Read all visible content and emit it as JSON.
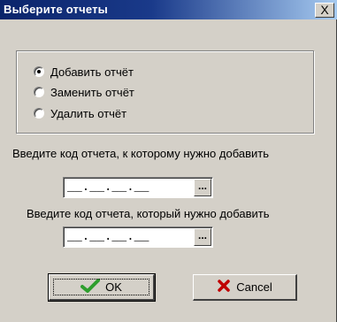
{
  "window": {
    "title": "Выберите отчеты",
    "close_label": "X"
  },
  "options": [
    {
      "label": "Добавить отчёт",
      "checked": true
    },
    {
      "label": "Заменить отчёт",
      "checked": false
    },
    {
      "label": "Удалить отчёт",
      "checked": false
    }
  ],
  "fields": {
    "target": {
      "prompt": "Введите код отчета, к которому нужно добавить",
      "value": "__.__.__.__",
      "button_label": "..."
    },
    "source": {
      "prompt": "Введите код отчета, который нужно добавить",
      "value": "__.__.__.__",
      "button_label": "..."
    }
  },
  "buttons": {
    "ok_label": "OK",
    "cancel_label": "Cancel"
  },
  "colors": {
    "title_bar": "#0a246a",
    "face": "#d4d0c8",
    "ok_icon": "#2e9e2e",
    "cancel_icon": "#c00000"
  },
  "icons": {
    "ok": "checkmark-icon",
    "cancel": "x-icon"
  }
}
